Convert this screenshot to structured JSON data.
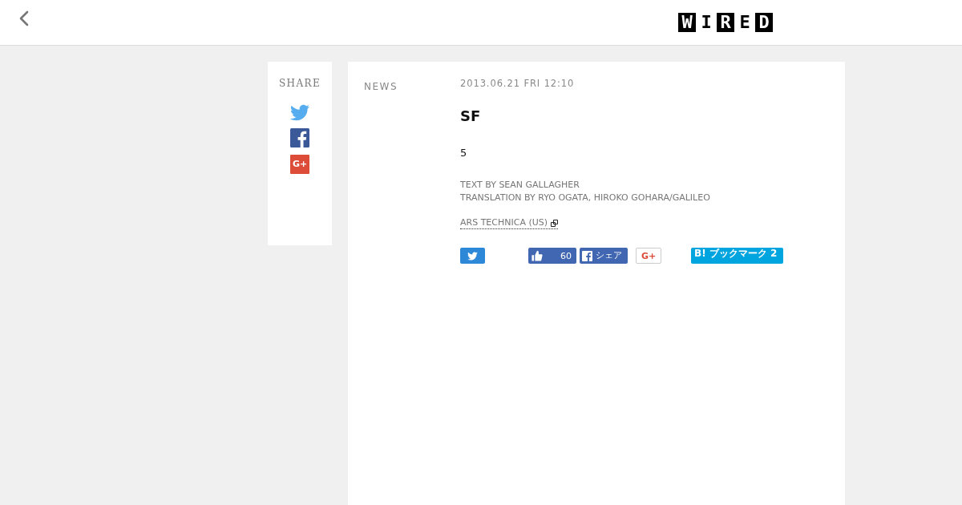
{
  "header": {
    "logo": [
      {
        "char": "W",
        "inverted": true
      },
      {
        "char": "I",
        "inverted": false
      },
      {
        "char": "R",
        "inverted": true
      },
      {
        "char": "E",
        "inverted": false
      },
      {
        "char": "D",
        "inverted": true
      }
    ]
  },
  "share_sidebar": {
    "title": "SHARE",
    "items": [
      {
        "kind": "twitter"
      },
      {
        "kind": "facebook"
      },
      {
        "kind": "google_plus",
        "label": "G+"
      }
    ]
  },
  "article": {
    "category": "NEWS",
    "date": "2013.06.21 FRI 12:10",
    "title": "SF",
    "body": "5",
    "credits": [
      "TEXT BY SEAN GALLAGHER",
      "TRANSLATION BY RYO OGATA, HIROKO GOHARA/GALILEO"
    ],
    "source_link": "ARS TECHNICA (US)"
  },
  "share_buttons": [
    {
      "kind": "tweet"
    },
    {
      "kind": "like",
      "count": "60"
    },
    {
      "kind": "share",
      "label": "シェア"
    },
    {
      "kind": "plus_one",
      "label": "G+"
    },
    {
      "kind": "bookmark",
      "label": "B! ブックマーク 2"
    }
  ]
}
